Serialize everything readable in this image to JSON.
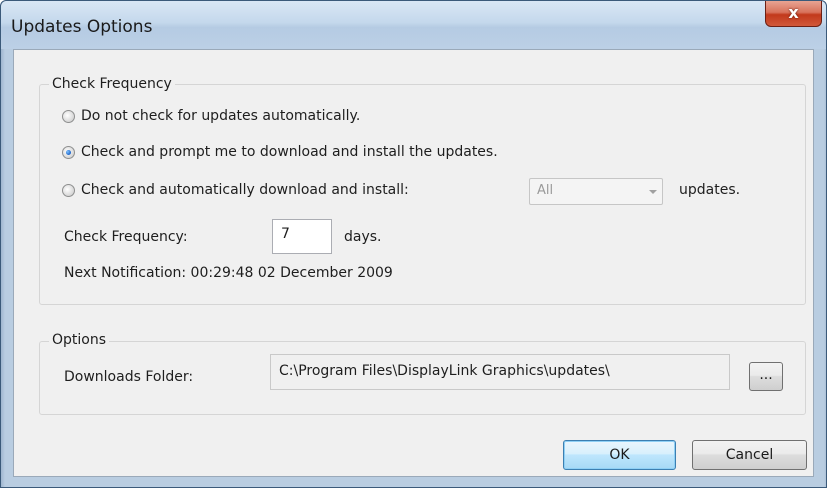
{
  "window": {
    "title": "Updates Options",
    "close_glyph": "x"
  },
  "check_frequency_group": {
    "label": "Check Frequency",
    "options": [
      {
        "label": "Do not check for updates automatically.",
        "selected": false
      },
      {
        "label": "Check and prompt me to download and install the updates.",
        "selected": true
      },
      {
        "label": "Check and automatically download and install:",
        "selected": false
      }
    ],
    "install_scope": {
      "value": "All",
      "suffix": "updates.",
      "enabled": false
    },
    "frequency": {
      "label": "Check Frequency:",
      "value": "7",
      "unit": "days."
    },
    "next_notification": "Next Notification: 00:29:48 02 December 2009"
  },
  "options_group": {
    "label": "Options",
    "downloads_folder_label": "Downloads Folder:",
    "downloads_folder_path": "C:\\Program Files\\DisplayLink Graphics\\updates\\",
    "browse_label": "..."
  },
  "buttons": {
    "ok": "OK",
    "cancel": "Cancel"
  },
  "colors": {
    "titlebar": "#c4d8ec",
    "close_button": "#c2391c",
    "dialog_background": "#f0f0f0",
    "default_button": "#bee6fd",
    "radio_selected": "#1c63c8"
  },
  "icons": {
    "close": "close-icon",
    "dropdown": "chevron-down-icon"
  }
}
